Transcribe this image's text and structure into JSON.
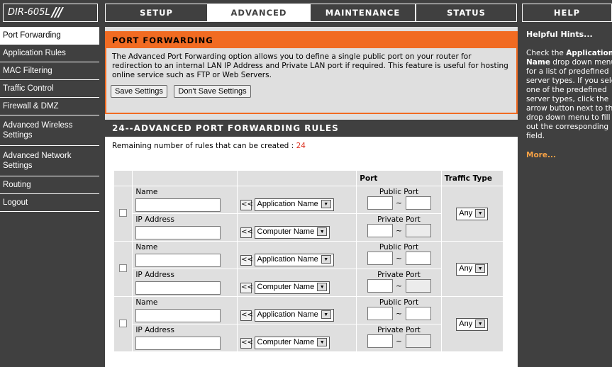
{
  "brand": {
    "model": "DIR-605L"
  },
  "nav_tabs": [
    {
      "label": "SETUP"
    },
    {
      "label": "ADVANCED"
    },
    {
      "label": "MAINTENANCE"
    },
    {
      "label": "STATUS"
    },
    {
      "label": "HELP"
    }
  ],
  "sidebar": {
    "items": [
      {
        "label": "Port Forwarding"
      },
      {
        "label": "Application Rules"
      },
      {
        "label": "MAC Filtering"
      },
      {
        "label": "Traffic Control"
      },
      {
        "label": "Firewall & DMZ"
      },
      {
        "label": "Advanced Wireless Settings"
      },
      {
        "label": "Advanced Network Settings"
      },
      {
        "label": "Routing"
      },
      {
        "label": "Logout"
      }
    ]
  },
  "port_forwarding": {
    "title": "PORT FORWARDING",
    "description": "The Advanced Port Forwarding option allows you to define a single public port on your router for redirection to an internal LAN IP Address and Private LAN port if required. This feature is useful for hosting online service such as FTP or Web Servers.",
    "save_label": "Save Settings",
    "dont_save_label": "Don't Save Settings"
  },
  "rules": {
    "title": "24--ADVANCED PORT FORWARDING RULES",
    "remaining_label": "Remaining number of rules that can be created :",
    "remaining_count": "24",
    "col_port": "Port",
    "col_traffic": "Traffic Type",
    "name_label": "Name",
    "ip_label": "IP Address",
    "app_select": "Application Name",
    "computer_select": "Computer Name",
    "public_port_label": "Public Port",
    "private_port_label": "Private Port",
    "tilde": "~",
    "arrow": "<<",
    "traffic_value": "Any",
    "rows": [
      {
        "name": "",
        "ip": ""
      },
      {
        "name": "",
        "ip": ""
      },
      {
        "name": "",
        "ip": ""
      }
    ]
  },
  "help": {
    "title": "Helpful Hints...",
    "lines": [
      "Check the Application",
      "Name drop down menu",
      "for a list of predefined",
      "server types. If you select",
      "one of the predefined",
      "server types, click the",
      "arrow button next to the",
      "drop down menu to fill",
      "out the corresponding",
      "field."
    ],
    "more": "More..."
  }
}
